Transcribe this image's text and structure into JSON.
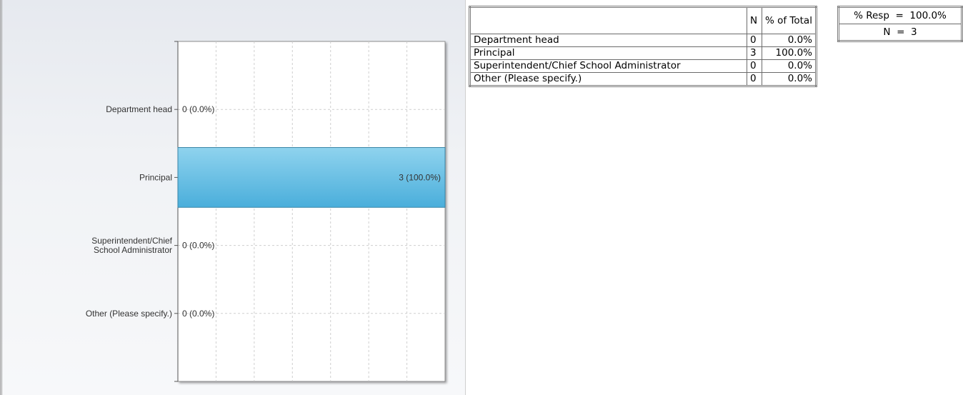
{
  "chart_data": {
    "type": "bar",
    "orientation": "horizontal",
    "categories": [
      "Department head",
      "Principal",
      "Superintendent/Chief School Administrator",
      "Other (Please specify.)"
    ],
    "category_display_lines": [
      [
        "Department head"
      ],
      [
        "Principal"
      ],
      [
        "Superintendent/Chief",
        "School Administrator"
      ],
      [
        "Other (Please specify.)"
      ]
    ],
    "values": [
      0,
      3,
      0,
      0
    ],
    "percentages": [
      0.0,
      100.0,
      0.0,
      0.0
    ],
    "data_labels": [
      "0 (0.0%)",
      "3 (100.0%)",
      "0 (0.0%)",
      "0 (0.0%)"
    ],
    "xlim": [
      0,
      3
    ],
    "grid": true,
    "bar_color": "#5bb8de"
  },
  "table": {
    "headers": [
      "",
      "N",
      "% of Total"
    ],
    "rows": [
      {
        "label": "Department head",
        "n": "0",
        "pct": "0.0%"
      },
      {
        "label": "Principal",
        "n": "3",
        "pct": "100.0%"
      },
      {
        "label": "Superintendent/Chief School Administrator",
        "n": "0",
        "pct": "0.0%"
      },
      {
        "label": "Other (Please specify.)",
        "n": "0",
        "pct": "0.0%"
      }
    ]
  },
  "summary": {
    "resp": "% Resp  =  100.0%",
    "n": "N  =  3"
  }
}
